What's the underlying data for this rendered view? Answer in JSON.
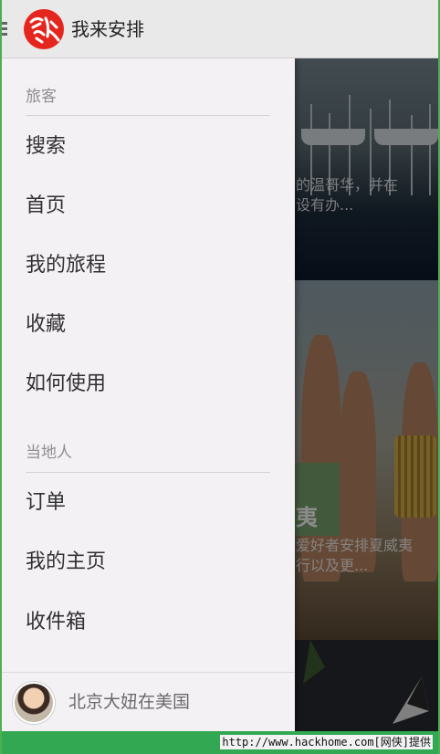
{
  "app_bar": {
    "title": "我来安排",
    "logo_text": "我来安排"
  },
  "feed": {
    "card1_caption_line1": "的温哥华，并在",
    "card1_caption_line2": "设有办...",
    "card2_title": "夷",
    "card2_caption_line1": "爱好者安排夏威夷",
    "card2_caption_line2": "行以及更..."
  },
  "drawer": {
    "section_traveler": "旅客",
    "traveler_items": [
      {
        "label": "搜索"
      },
      {
        "label": "首页"
      },
      {
        "label": "我的旅程"
      },
      {
        "label": "收藏"
      },
      {
        "label": "如何使用"
      }
    ],
    "section_local": "当地人",
    "local_items": [
      {
        "label": "订单"
      },
      {
        "label": "我的主页"
      },
      {
        "label": "收件箱"
      }
    ],
    "profile_name": "北京大妞在美国"
  },
  "watermark": {
    "text": "http://www.hackhome.com[网侠]提供"
  },
  "colors": {
    "logo_red": "#e5261f",
    "drawer_bg": "#f4f1f5",
    "appbar_bg": "#e9e9e9",
    "watermark_green": "#32a852"
  }
}
